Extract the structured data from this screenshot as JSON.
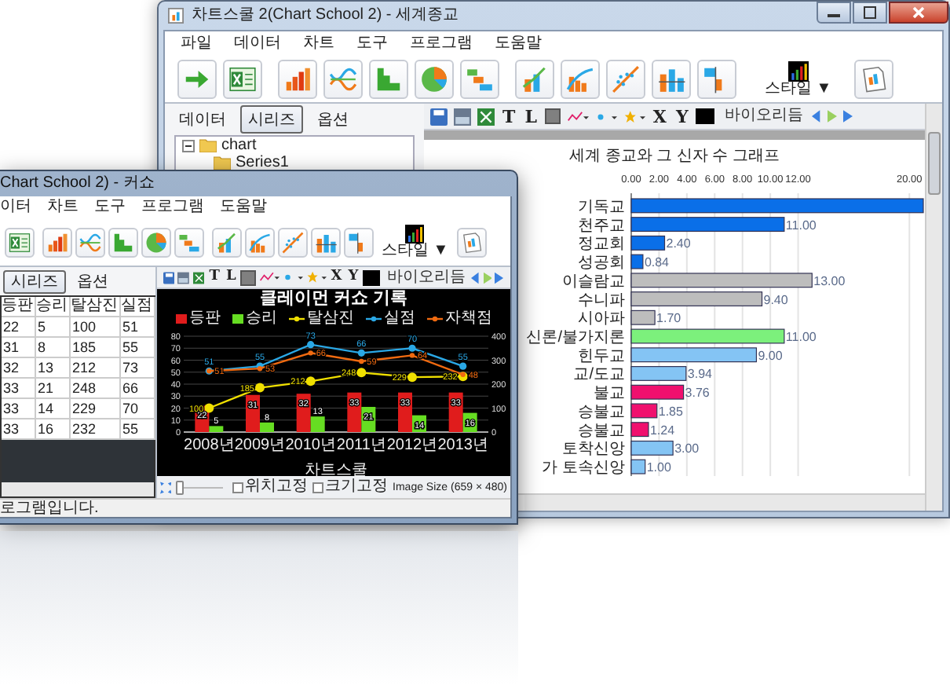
{
  "back_window": {
    "title": "차트스쿨 2(Chart School 2) - 세계종교",
    "menu": [
      "파일",
      "데이터",
      "차트",
      "도구",
      "프로그램",
      "도움말"
    ],
    "style_button": "스타일 ▼",
    "tabs": [
      {
        "label": "데이터",
        "selected": false
      },
      {
        "label": "시리즈",
        "selected": true
      },
      {
        "label": "옵션",
        "selected": false
      }
    ],
    "tree": [
      {
        "label": "chart",
        "expanded": true,
        "children": [
          {
            "label": "Series1"
          }
        ]
      }
    ],
    "chart_toolbar": {
      "t_button": "T",
      "l_button": "L",
      "x_button": "X",
      "y_button": "Y",
      "biorhythm": "바이오리듬"
    },
    "chart": {
      "title": "세계 종교와 그 신자 수 그래프",
      "chart_data": {
        "type": "bar",
        "orientation": "horizontal",
        "stacked": true,
        "grid": true,
        "categories": [
          "기독교",
          "천주교",
          "정교회",
          "성공회",
          "이슬람교",
          "수니파",
          "시아파",
          "신론/불가지론",
          "힌두교",
          "교/도교",
          "불교",
          "승불교",
          "승불교",
          "토착신앙",
          "가 토속신앙"
        ],
        "series": [
          {
            "color": "#0a6fe8",
            "values": [
              21,
              11,
              2.4,
              0.84,
              null,
              null,
              null,
              null,
              null,
              null,
              null,
              null,
              null,
              null,
              null
            ]
          },
          {
            "color": "#bdbdbd",
            "values": [
              null,
              null,
              null,
              null,
              13,
              9.4,
              1.7,
              null,
              null,
              null,
              null,
              null,
              null,
              null,
              null
            ]
          },
          {
            "color": "#7cf07c",
            "values": [
              null,
              null,
              null,
              null,
              null,
              null,
              null,
              11,
              null,
              null,
              null,
              null,
              null,
              null,
              null
            ]
          },
          {
            "color": "#84c4f4",
            "values": [
              null,
              null,
              null,
              null,
              null,
              null,
              null,
              null,
              9,
              3.94,
              null,
              null,
              null,
              3,
              1
            ]
          },
          {
            "color": "#f0106e",
            "values": [
              null,
              null,
              null,
              null,
              null,
              null,
              null,
              null,
              null,
              null,
              3.76,
              1.85,
              1.24,
              null,
              null
            ]
          }
        ],
        "value_labels": [
          null,
          "11.00",
          "2.40",
          "0.84",
          "13.00",
          "9.40",
          "1.70",
          "11.00",
          "9.00",
          "3.94",
          "3.76",
          "1.85",
          "1.24",
          "3.00",
          "1.00"
        ],
        "xlim": [
          0,
          21
        ],
        "xticks": [
          {
            "value": 0,
            "label": "0.00"
          },
          {
            "value": 2,
            "label": "2.00"
          },
          {
            "value": 4,
            "label": "4.00"
          },
          {
            "value": 6,
            "label": "6.00"
          },
          {
            "value": 8,
            "label": "8.00"
          },
          {
            "value": 10,
            "label": "10.00"
          },
          {
            "value": 12,
            "label": "12.00"
          },
          {
            "value": 20,
            "label": "20.00"
          }
        ]
      }
    }
  },
  "front_window": {
    "title": "Chart School 2) - 커쇼",
    "menu": [
      "이터",
      "차트",
      "도구",
      "프로그램",
      "도움말"
    ],
    "style_button": "스타일 ▼",
    "tabs": [
      {
        "label": "시리즈",
        "selected": true
      },
      {
        "label": "옵션",
        "selected": false
      }
    ],
    "table": {
      "columns": [
        "등판",
        "승리",
        "탈삼진",
        "실점"
      ],
      "rows": [
        [
          "22",
          "5",
          "100",
          "51"
        ],
        [
          "31",
          "8",
          "185",
          "55"
        ],
        [
          "32",
          "13",
          "212",
          "73"
        ],
        [
          "33",
          "21",
          "248",
          "66"
        ],
        [
          "33",
          "14",
          "229",
          "70"
        ],
        [
          "33",
          "16",
          "232",
          "55"
        ]
      ]
    },
    "chart_toolbar": {
      "t_button": "T",
      "l_button": "L",
      "x_button": "X",
      "y_button": "Y",
      "biorhythm": "바이오리듬"
    },
    "chart": {
      "chart_data": {
        "type": "bar",
        "title": "클레이먼 커쇼 기록",
        "xlabel": "차트스쿨",
        "stacked": false,
        "grid": true,
        "legend": "top",
        "categories": [
          "2008년",
          "2009년",
          "2010년",
          "2011년",
          "2012년",
          "2013년"
        ],
        "series": [
          {
            "name": "등판",
            "type": "bar",
            "color": "#e01c1c",
            "values": [
              22,
              31,
              32,
              33,
              33,
              33
            ]
          },
          {
            "name": "승리",
            "type": "bar",
            "color": "#66dd22",
            "values": [
              5,
              8,
              13,
              21,
              14,
              16
            ]
          },
          {
            "name": "탈삼진",
            "type": "line",
            "axis": "y2",
            "marker": "circle",
            "color": "#f0e000",
            "values": [
              100,
              185,
              212,
              248,
              229,
              232
            ]
          },
          {
            "name": "실점",
            "type": "line",
            "marker": "circle",
            "color": "#2aa8e6",
            "values": [
              51,
              55,
              73,
              66,
              70,
              55
            ]
          },
          {
            "name": "자책점",
            "type": "line",
            "marker": "circle",
            "color": "#f06a10",
            "values": [
              51,
              53,
              66,
              59,
              64,
              48
            ]
          }
        ],
        "ylim": [
          0,
          80
        ],
        "yticks": [
          0,
          10,
          20,
          30,
          40,
          50,
          60,
          70,
          80
        ],
        "y2lim": [
          0,
          400
        ],
        "y2ticks": [
          0,
          100,
          200,
          300,
          400
        ],
        "data_labels": true
      }
    },
    "bottom_bar": {
      "zoom_slider": {
        "level": 0
      },
      "checkboxes": [
        {
          "label": "위치고정",
          "checked": false
        },
        {
          "label": "크기고정",
          "checked": false
        }
      ],
      "image_size": "Image Size (659 × 480)"
    },
    "status_bar": "로그램입니다."
  }
}
